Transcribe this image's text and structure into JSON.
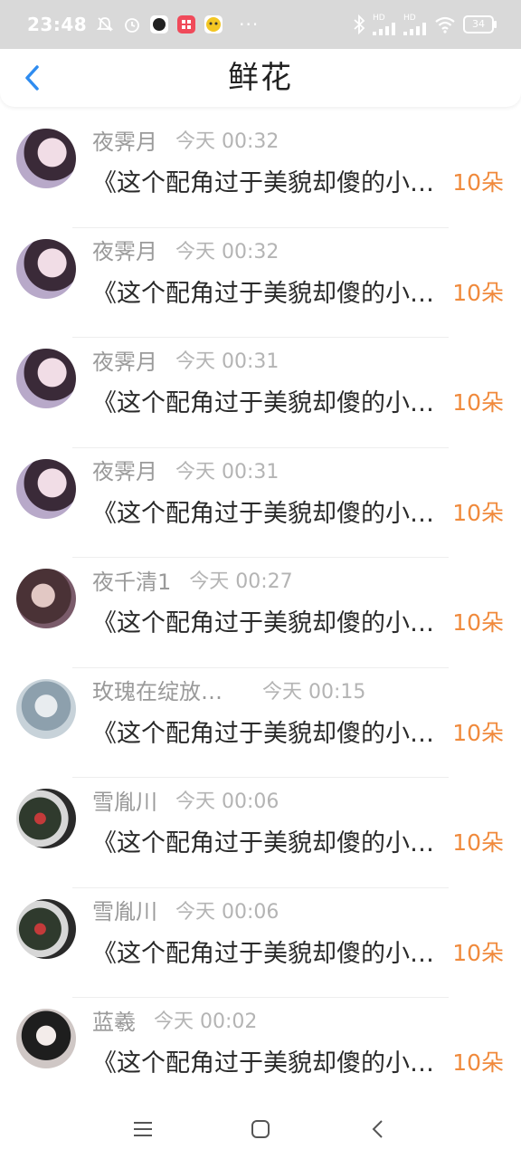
{
  "status_bar": {
    "time": "23:48",
    "hd1": "HD",
    "hd2": "HD",
    "battery": "34",
    "icons": [
      "mute-bell-icon",
      "alarm-icon",
      "app-icon-dark",
      "app-icon-red",
      "app-icon-yellow",
      "bluetooth-icon",
      "signal-icon",
      "signal-icon",
      "wifi-icon",
      "battery-icon"
    ]
  },
  "header": {
    "title": "鲜花",
    "back_icon": "chevron-left-icon"
  },
  "accent_color": "#2f8cf0",
  "count_color": "#f08a3c",
  "items": [
    {
      "name": "夜霁月",
      "time": "今天 00:32",
      "message": "《这个配角过于美貌却傻的小说》",
      "count": "10朵"
    },
    {
      "name": "夜霁月",
      "time": "今天 00:32",
      "message": "《这个配角过于美貌却傻的小说》",
      "count": "10朵"
    },
    {
      "name": "夜霁月",
      "time": "今天 00:31",
      "message": "《这个配角过于美貌却傻的小说》",
      "count": "10朵"
    },
    {
      "name": "夜霁月",
      "time": "今天 00:31",
      "message": "《这个配角过于美貌却傻的小说》",
      "count": "10朵"
    },
    {
      "name": "夜千清1",
      "time": "今天 00:27",
      "message": "《这个配角过于美貌却傻的小说》",
      "count": "10朵"
    },
    {
      "name": "玫瑰在绽放…",
      "time": "今天 00:15",
      "message": "《这个配角过于美貌却傻的小说》",
      "count": "10朵"
    },
    {
      "name": "雪胤川",
      "time": "今天 00:06",
      "message": "《这个配角过于美貌却傻的小说》",
      "count": "10朵"
    },
    {
      "name": "雪胤川",
      "time": "今天 00:06",
      "message": "《这个配角过于美貌却傻的小说》",
      "count": "10朵"
    },
    {
      "name": "蓝羲",
      "time": "今天 00:02",
      "message": "《这个配角过于美貌却傻的小说》",
      "count": "10朵"
    }
  ],
  "nav_bar": {
    "icons": [
      "menu-icon",
      "home-icon",
      "back-icon"
    ]
  }
}
